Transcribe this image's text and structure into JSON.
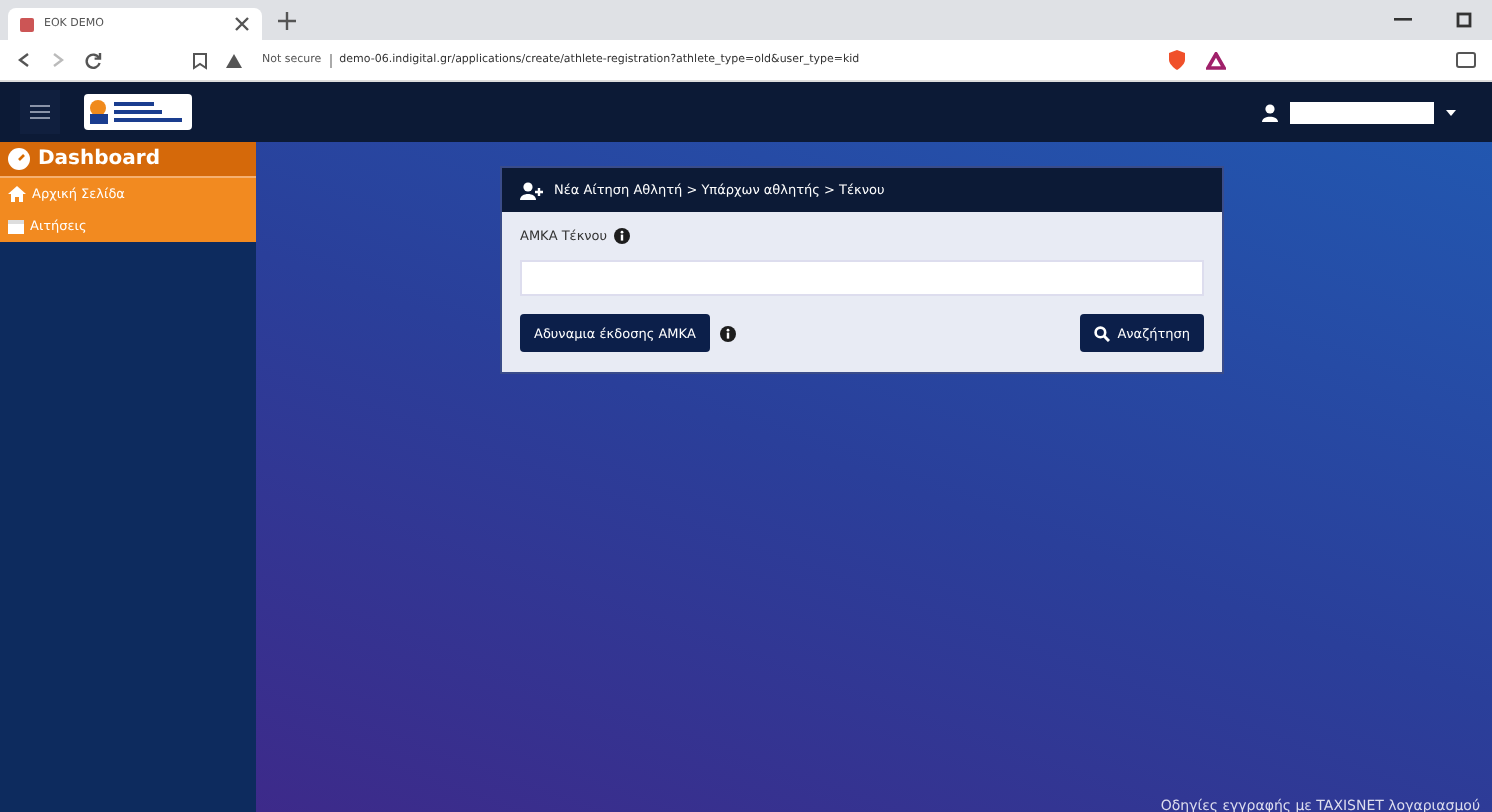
{
  "browser": {
    "tab_title": "ΕΟΚ DEMO",
    "address_warning": "Not secure",
    "url": "demo-06.indigital.gr/applications/create/athlete-registration?athlete_type=old&user_type=kid"
  },
  "sidebar": {
    "header": "Dashboard",
    "items": [
      {
        "label": "Αρχική Σελίδα",
        "kind": "home"
      },
      {
        "label": "Αιτήσεις",
        "kind": "list"
      }
    ]
  },
  "card": {
    "breadcrumb": "Νέα Αίτηση Αθλητή > Υπάρχων αθλητής > Τέκνου",
    "field_label": "ΑΜΚΑ Τέκνου",
    "buttons": [
      {
        "label": "Αδυναμια έκδοσης ΑΜΚΑ",
        "kind": "info"
      },
      {
        "label": "Αναζήτηση",
        "kind": "search"
      }
    ]
  },
  "footer_link": "Οδηγίες εγγραφής με TAXISNET λογαριασμού"
}
